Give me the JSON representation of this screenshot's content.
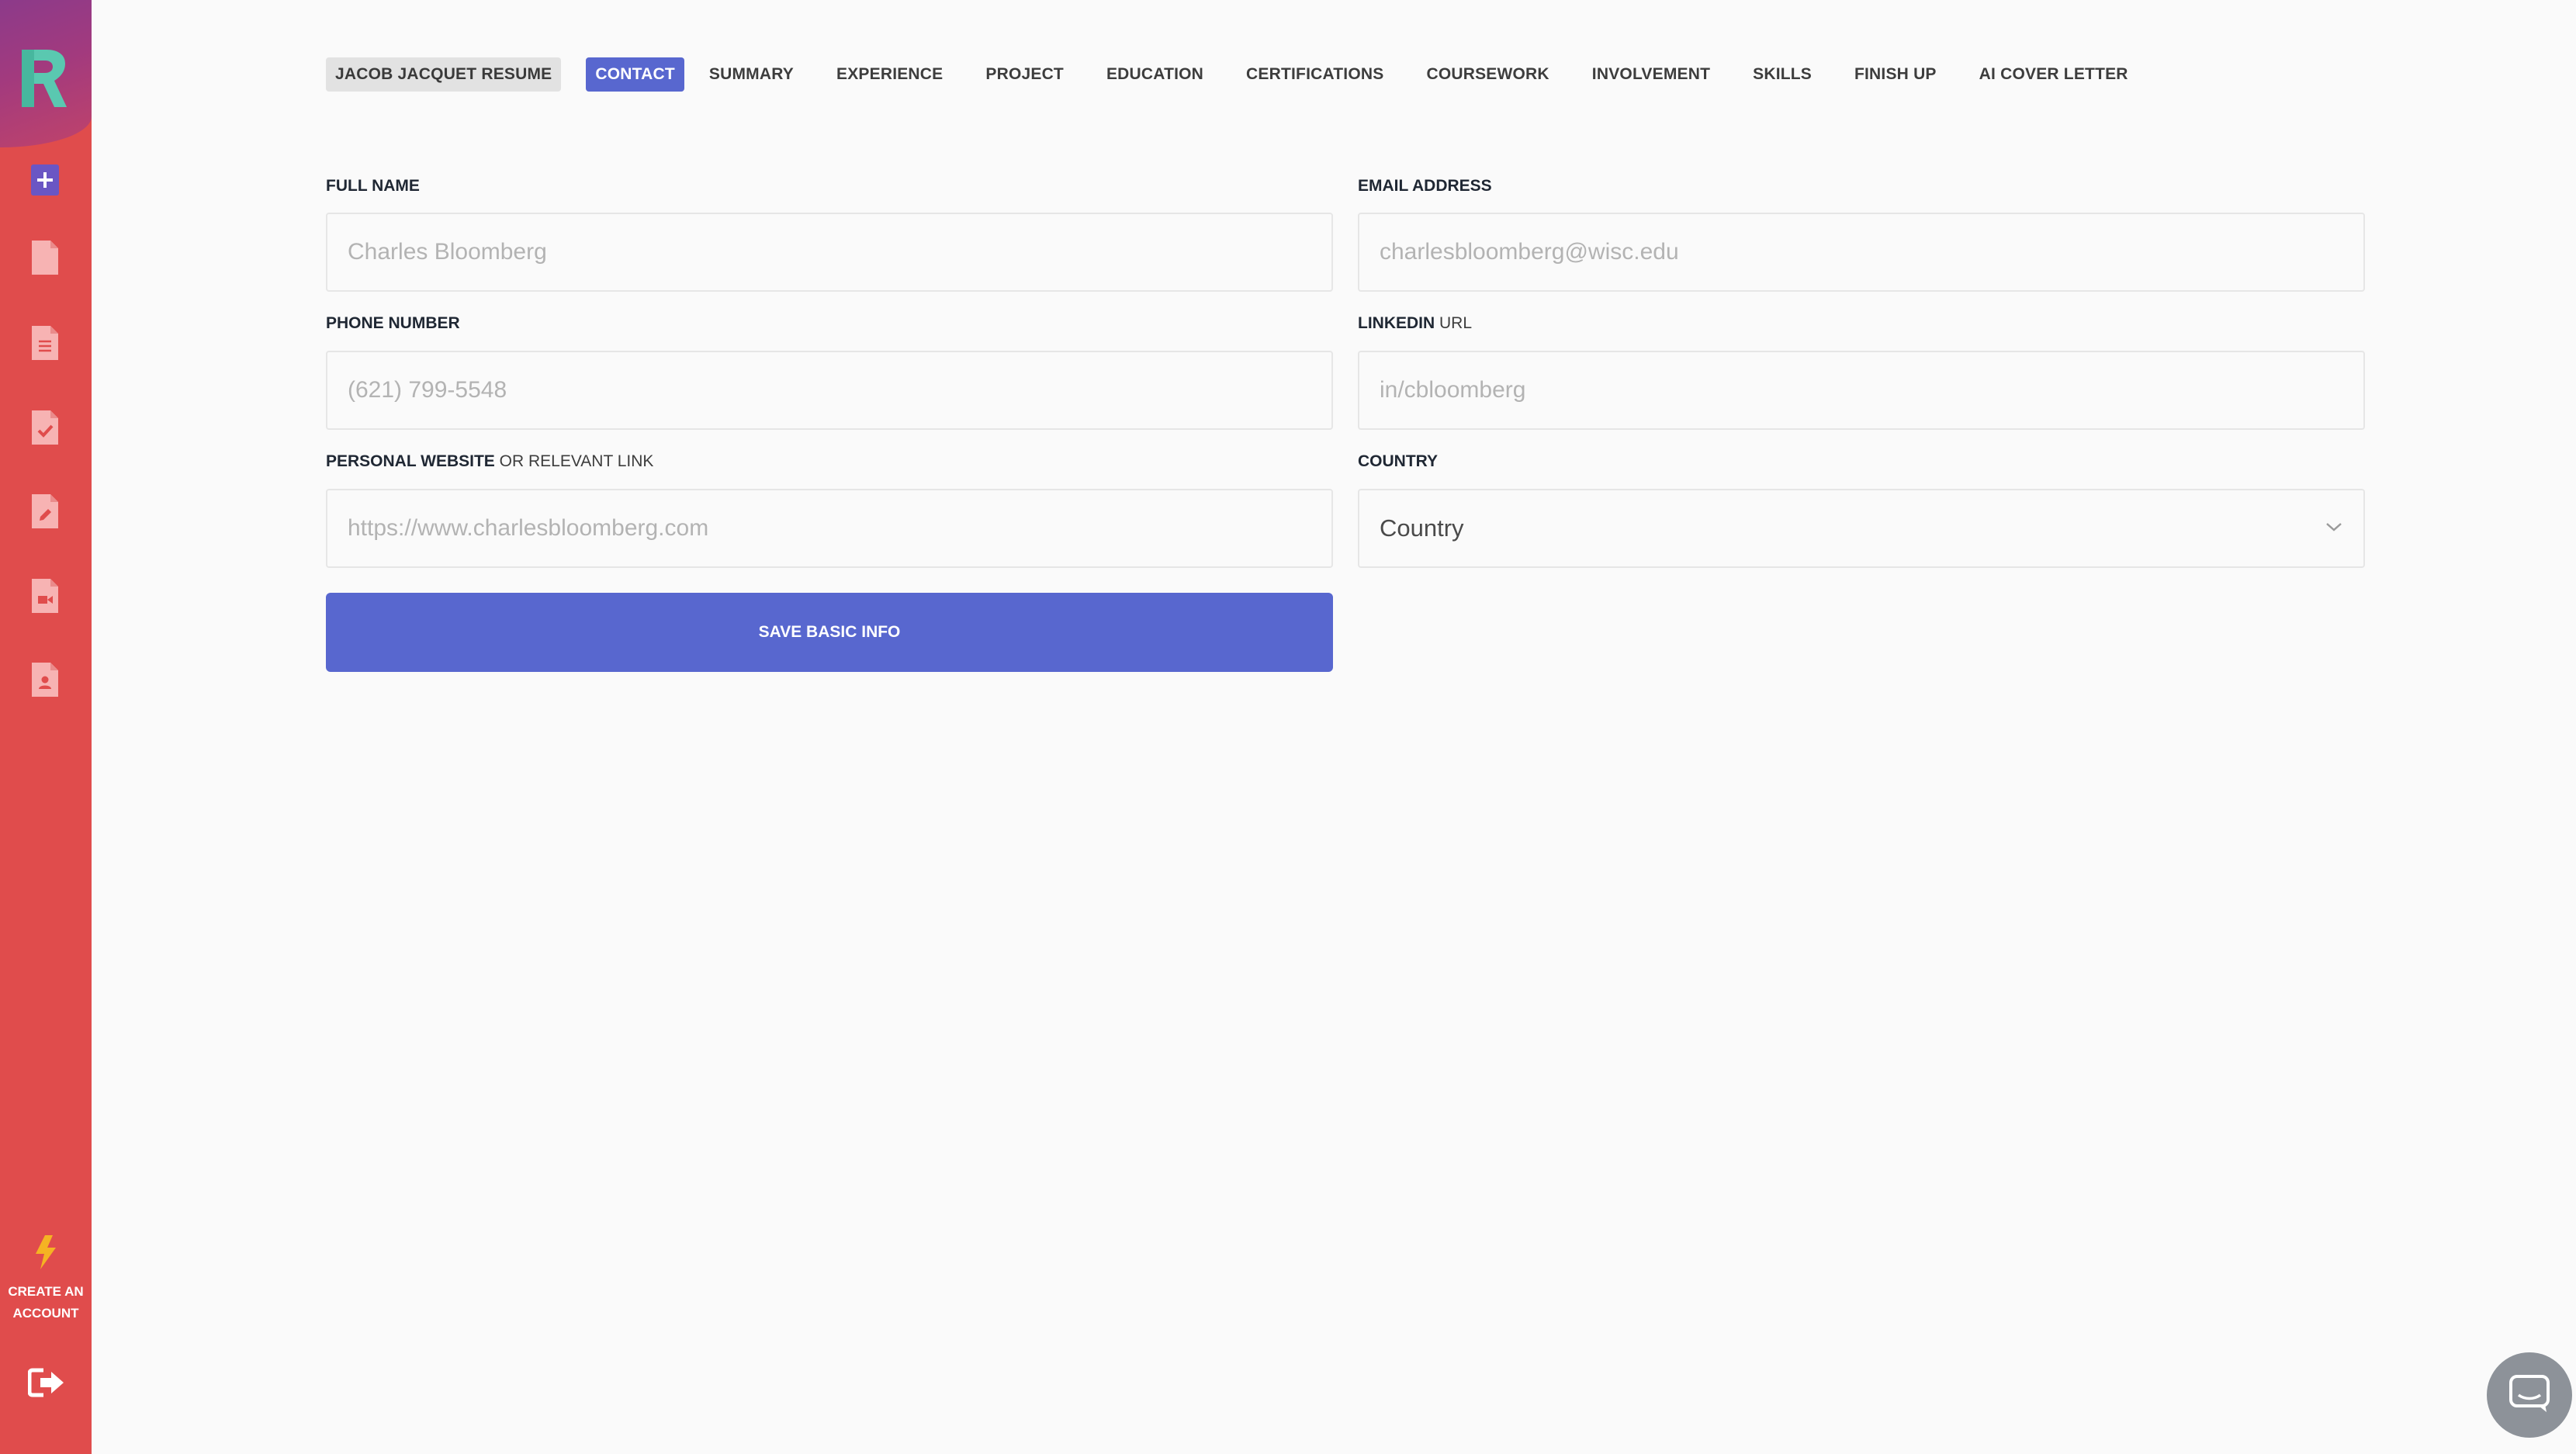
{
  "colors": {
    "sidebar": "#e04c4c",
    "sidebar_top": "#a23a7e",
    "accent": "#5867cf",
    "bolt": "#f5b323",
    "page_bg": "#fafafa"
  },
  "sidebar": {
    "icons": [
      "new-document-icon",
      "document-icon",
      "document-lines-icon",
      "document-check-icon",
      "document-edit-icon",
      "document-video-icon",
      "document-user-icon"
    ],
    "cta_line1": "CREATE AN",
    "cta_line2": "ACCOUNT",
    "cta_icon": "lightning-bolt-icon",
    "logout_icon": "logout-icon"
  },
  "nav": {
    "resume_name": "JACOB JACQUET RESUME",
    "tabs": [
      {
        "label": "CONTACT",
        "active": true
      },
      {
        "label": "SUMMARY"
      },
      {
        "label": "EXPERIENCE"
      },
      {
        "label": "PROJECT"
      },
      {
        "label": "EDUCATION"
      },
      {
        "label": "CERTIFICATIONS"
      },
      {
        "label": "COURSEWORK"
      },
      {
        "label": "INVOLVEMENT"
      },
      {
        "label": "SKILLS"
      },
      {
        "label": "FINISH UP"
      },
      {
        "label": "AI COVER LETTER"
      }
    ]
  },
  "form": {
    "full_name": {
      "label": "FULL NAME",
      "placeholder": "Charles Bloomberg",
      "value": ""
    },
    "email": {
      "label": "EMAIL ADDRESS",
      "placeholder": "charlesbloomberg@wisc.edu",
      "value": ""
    },
    "phone": {
      "label": "PHONE NUMBER",
      "placeholder": "(621) 799-5548",
      "value": ""
    },
    "linkedin": {
      "label_bold": "LINKEDIN",
      "label_light": "URL",
      "placeholder": "in/cbloomberg",
      "value": ""
    },
    "website": {
      "label_bold": "PERSONAL WEBSITE",
      "label_light": "OR RELEVANT LINK",
      "placeholder": "https://www.charlesbloomberg.com",
      "value": ""
    },
    "country": {
      "label": "COUNTRY",
      "selected": "Country"
    },
    "save_label": "SAVE BASIC INFO"
  },
  "chat": {
    "icon": "chat-bubble-icon"
  }
}
